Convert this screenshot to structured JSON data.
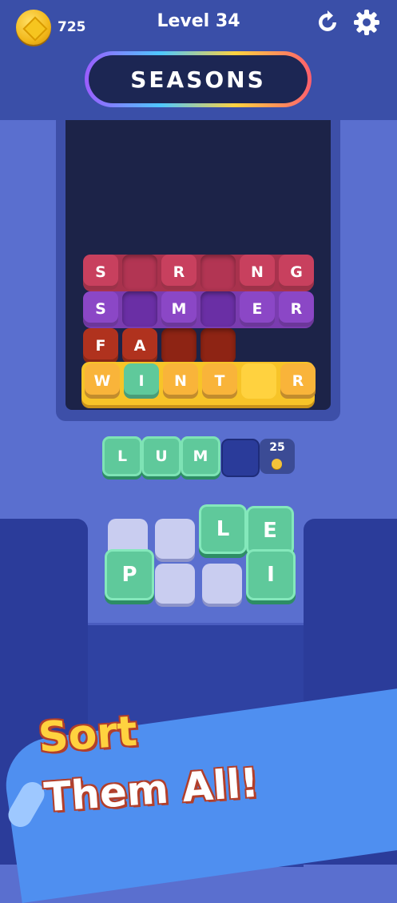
{
  "header": {
    "coins": "725",
    "level": "Level 34",
    "restart_icon": "restart-icon",
    "settings_icon": "gear-icon"
  },
  "category": {
    "title": "SEASONS"
  },
  "board": {
    "colors": {
      "spring": "#c8405e",
      "summer": "#8b47c6",
      "fall": "#b0321e",
      "winter": "#f7c428",
      "background": "#1c2348"
    },
    "rows": [
      {
        "word": "SPRING",
        "letters": [
          "S",
          "",
          "R",
          "",
          "N",
          "G"
        ]
      },
      {
        "word": "SUMMER",
        "letters": [
          "S",
          "",
          "M",
          "",
          "E",
          "R"
        ]
      },
      {
        "word": "FALL",
        "letters": [
          "F",
          "A",
          "",
          ""
        ]
      },
      {
        "word": "WINTER",
        "letters": [
          "W",
          "I",
          "N",
          "T",
          "",
          "R"
        ]
      }
    ]
  },
  "tray": {
    "letters": [
      "L",
      "U",
      "M"
    ],
    "slot_cost": "25"
  },
  "picker": {
    "letters": {
      "l": "L",
      "e": "E",
      "p": "P",
      "i": "I"
    }
  },
  "promo": {
    "line1": "Sort",
    "line2": "Them All!"
  }
}
